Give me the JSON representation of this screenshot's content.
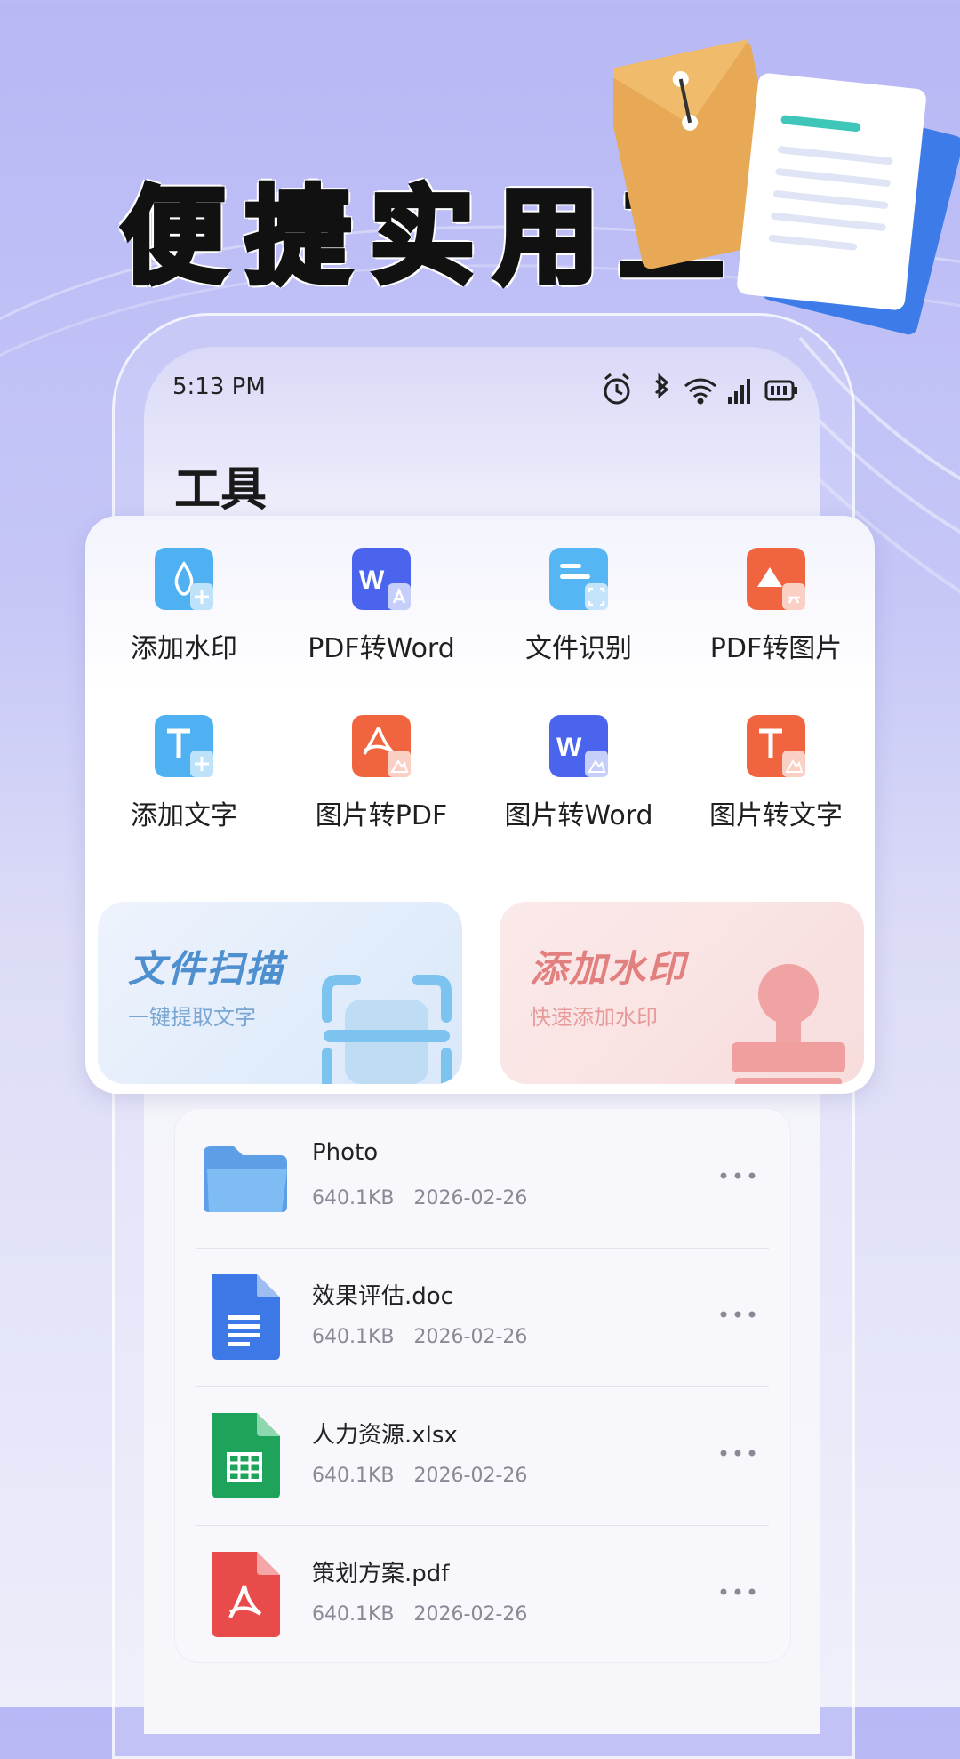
{
  "headline": "便捷实用工具",
  "status_bar": {
    "time": "5:13 PM"
  },
  "page_title": "工具",
  "tools": [
    {
      "label": "添加水印",
      "icon": "watermark-add-icon"
    },
    {
      "label": "PDF转Word",
      "icon": "pdf-to-word-icon"
    },
    {
      "label": "文件识别",
      "icon": "file-recognize-icon"
    },
    {
      "label": "PDF转图片",
      "icon": "pdf-to-image-icon"
    },
    {
      "label": "添加文字",
      "icon": "text-add-icon"
    },
    {
      "label": "图片转PDF",
      "icon": "image-to-pdf-icon"
    },
    {
      "label": "图片转Word",
      "icon": "image-to-word-icon"
    },
    {
      "label": "图片转文字",
      "icon": "image-to-text-icon"
    }
  ],
  "banners": [
    {
      "title": "文件扫描",
      "subtitle": "一键提取文字",
      "icon": "scan-icon"
    },
    {
      "title": "添加水印",
      "subtitle": "快速添加水印",
      "icon": "stamp-icon"
    }
  ],
  "files": [
    {
      "name": "Photo",
      "size": "640.1KB",
      "date": "2026-02-26",
      "icon": "folder-icon"
    },
    {
      "name": "效果评估.doc",
      "size": "640.1KB",
      "date": "2026-02-26",
      "icon": "doc-file-icon"
    },
    {
      "name": "人力资源.xlsx",
      "size": "640.1KB",
      "date": "2026-02-26",
      "icon": "xlsx-file-icon"
    },
    {
      "name": "策划方案.pdf",
      "size": "640.1KB",
      "date": "2026-02-26",
      "icon": "pdf-file-icon"
    }
  ],
  "colors": {
    "accent_blue": "#4b6cf0",
    "accent_red": "#ef6a48",
    "scan_banner": "#e4eefb",
    "watermark_banner": "#fbe4e4"
  }
}
